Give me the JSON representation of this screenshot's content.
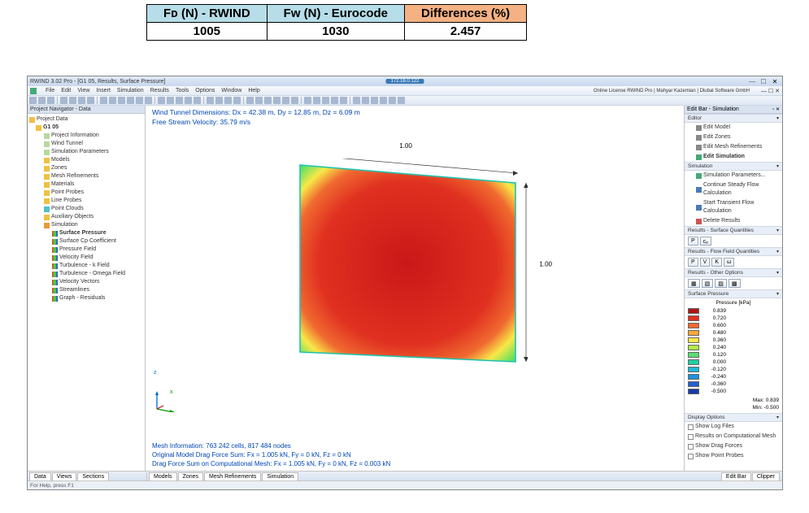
{
  "comparison_table": {
    "headers": [
      "Fᴅ (N) - RWIND",
      "Fᴡ (N) - Eurocode",
      "Differences (%)"
    ],
    "values": [
      "1005",
      "1030",
      "2.457"
    ]
  },
  "titlebar": {
    "caption": "RWIND 3.02 Pro - [G1 05, Results, Surface Pressure]",
    "center_ip": "172.16.0.122"
  },
  "menu": {
    "items": [
      "File",
      "Edit",
      "View",
      "Insert",
      "Simulation",
      "Results",
      "Tools",
      "Options",
      "Window",
      "Help"
    ],
    "right_text": "Online License RWIND Pro | Mahyar Kazemian | Dlubal Software GmbH"
  },
  "left_panel": {
    "title": "Project Navigator - Data",
    "proj_root": "Project Data",
    "case": "G1 05",
    "items": {
      "proj_info": "Project Information",
      "wind_tun": "Wind Tunnel",
      "sim_par": "Simulation Parameters",
      "models": "Models",
      "zones": "Zones",
      "mesh_ref": "Mesh Refinements",
      "materials": "Materials",
      "point_probes": "Point Probes",
      "line_probes": "Line Probes",
      "point_clouds": "Point Clouds",
      "aux_objects": "Auxiliary Objects",
      "simulation": "Simulation",
      "surf_press": "Surface Pressure",
      "surf_cp": "Surface Cp Coefficient",
      "press_field": "Pressure Field",
      "vel_field": "Velocity Field",
      "turb_k": "Turbulence - k Field",
      "turb_o": "Turbulence - Omega Field",
      "vel_vec": "Velocity Vectors",
      "stream": "Streamlines",
      "graph": "Graph - Residuals"
    }
  },
  "viewport": {
    "dims": "Wind Tunnel Dimensions: Dx = 42.38 m, Dy = 12.85 m, Dz = 6.09 m",
    "vel": "Free Stream Velocity: 35.79 m/s",
    "dim_top": "1.00",
    "dim_right": "1.00",
    "mesh": "Mesh Information: 763 242 cells, 817 484 nodes",
    "drag1": "Original Model Drag Force Sum: Fx = 1.005 kN, Fy = 0 kN, Fz = 0 kN",
    "drag2": "Drag Force Sum on Computational Mesh: Fx = 1.005 kN, Fy = 0 kN, Fz = 0.003 kN",
    "z": "z",
    "x": "x"
  },
  "right_panel": {
    "header": "Edit Bar - Simulation",
    "editor_grp": "Editor",
    "editor_items": [
      "Edit Model",
      "Edit Zones",
      "Edit Mesh Refinements",
      "Edit Simulation"
    ],
    "sim_grp": "Simulation",
    "sim_items": [
      "Simulation Parameters...",
      "Continue Steady Flow Calculation",
      "Start Transient Flow Calculation",
      "Delete Results"
    ],
    "res_surf": "Results - Surface Quantities",
    "btn_surf": [
      "P",
      "cₚ"
    ],
    "res_flow": "Results - Flow Field Quantities",
    "btn_flow": [
      "P",
      "V",
      "K",
      "ω"
    ],
    "res_other": "Results - Other Options",
    "surf_press_grp": "Surface Pressure",
    "legend_title": "Pressure [kPa]",
    "legend_vals": [
      "0.839",
      "0.720",
      "0.600",
      "0.480",
      "0.360",
      "0.240",
      "0.120",
      "0.000",
      "-0.120",
      "-0.240",
      "-0.360",
      "-0.500"
    ],
    "legend_colors": [
      "#b21618",
      "#e03020",
      "#f06a30",
      "#f8a838",
      "#f8e848",
      "#b0e848",
      "#58e070",
      "#20d0a0",
      "#20b8d8",
      "#2090e0",
      "#2060d0",
      "#1838a8"
    ],
    "max": "Max: 0.839",
    "min": "Min: -0.500",
    "disp_grp": "Display Options",
    "disp_items": [
      "Show Log Files",
      "Results on Computational Mesh",
      "Show Drag Forces",
      "Show Point Probes"
    ]
  },
  "bottom_tabs": {
    "left": [
      "Data",
      "Views",
      "Sections"
    ],
    "mid": [
      "Models",
      "Zones",
      "Mesh Refinements",
      "Simulation"
    ],
    "right": [
      "Edit Bar",
      "Clipper"
    ]
  },
  "status": {
    "text": "For Help, press F1"
  },
  "chart_data": {
    "type": "heatmap",
    "title": "Surface Pressure",
    "field": "Pressure",
    "units": "kPa",
    "object_dimensions": {
      "width": 1.0,
      "height": 1.0
    },
    "colorbar": {
      "label": "Pressure [kPa]",
      "range": [
        -0.5,
        0.839
      ],
      "ticks": [
        0.839,
        0.72,
        0.6,
        0.48,
        0.36,
        0.24,
        0.12,
        0.0,
        -0.12,
        -0.24,
        -0.36,
        -0.5
      ],
      "colors": [
        "#b21618",
        "#e03020",
        "#f06a30",
        "#f8a838",
        "#f8e848",
        "#b0e848",
        "#58e070",
        "#20d0a0",
        "#20b8d8",
        "#2090e0",
        "#2060d0",
        "#1838a8"
      ]
    },
    "context": {
      "wind_tunnel": {
        "Dx": 42.38,
        "Dy": 12.85,
        "Dz": 6.09,
        "units": "m"
      },
      "free_stream_velocity": {
        "value": 35.79,
        "units": "m/s"
      },
      "mesh": {
        "cells": 763242,
        "nodes": 817484
      },
      "original_drag_force_kN": {
        "Fx": 1.005,
        "Fy": 0,
        "Fz": 0
      },
      "computational_mesh_drag_force_kN": {
        "Fx": 1.005,
        "Fy": 0,
        "Fz": 0.003
      }
    }
  }
}
